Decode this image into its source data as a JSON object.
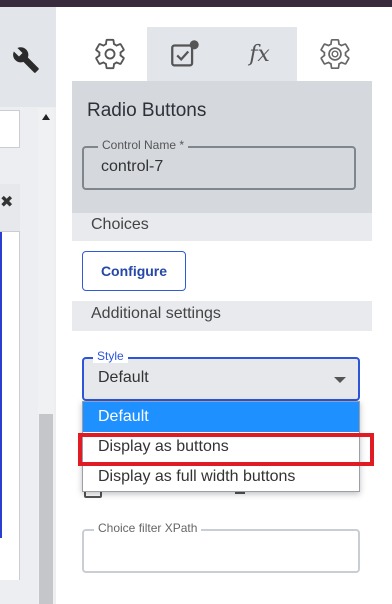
{
  "tabs": [
    {
      "name": "settings"
    },
    {
      "name": "validation"
    },
    {
      "name": "calculation",
      "label": "fx"
    },
    {
      "name": "advanced"
    }
  ],
  "panel": {
    "title": "Radio Buttons",
    "control_name_label": "Control Name *",
    "control_name_value": "control-7",
    "choices_label": "Choices",
    "configure_label": "Configure",
    "additional_label": "Additional settings"
  },
  "style": {
    "legend": "Style",
    "value": "Default",
    "options": [
      "Default",
      "Display as buttons",
      "Display as full width buttons"
    ],
    "selected_index": 0,
    "highlighted_index": 1
  },
  "xpath": {
    "legend": "Choice filter XPath",
    "value": ""
  },
  "colors": {
    "accent": "#2c55d9",
    "selected_option": "#1e90ff",
    "highlight_outline": "#e01b24",
    "section_bg": "#d5d9de"
  }
}
